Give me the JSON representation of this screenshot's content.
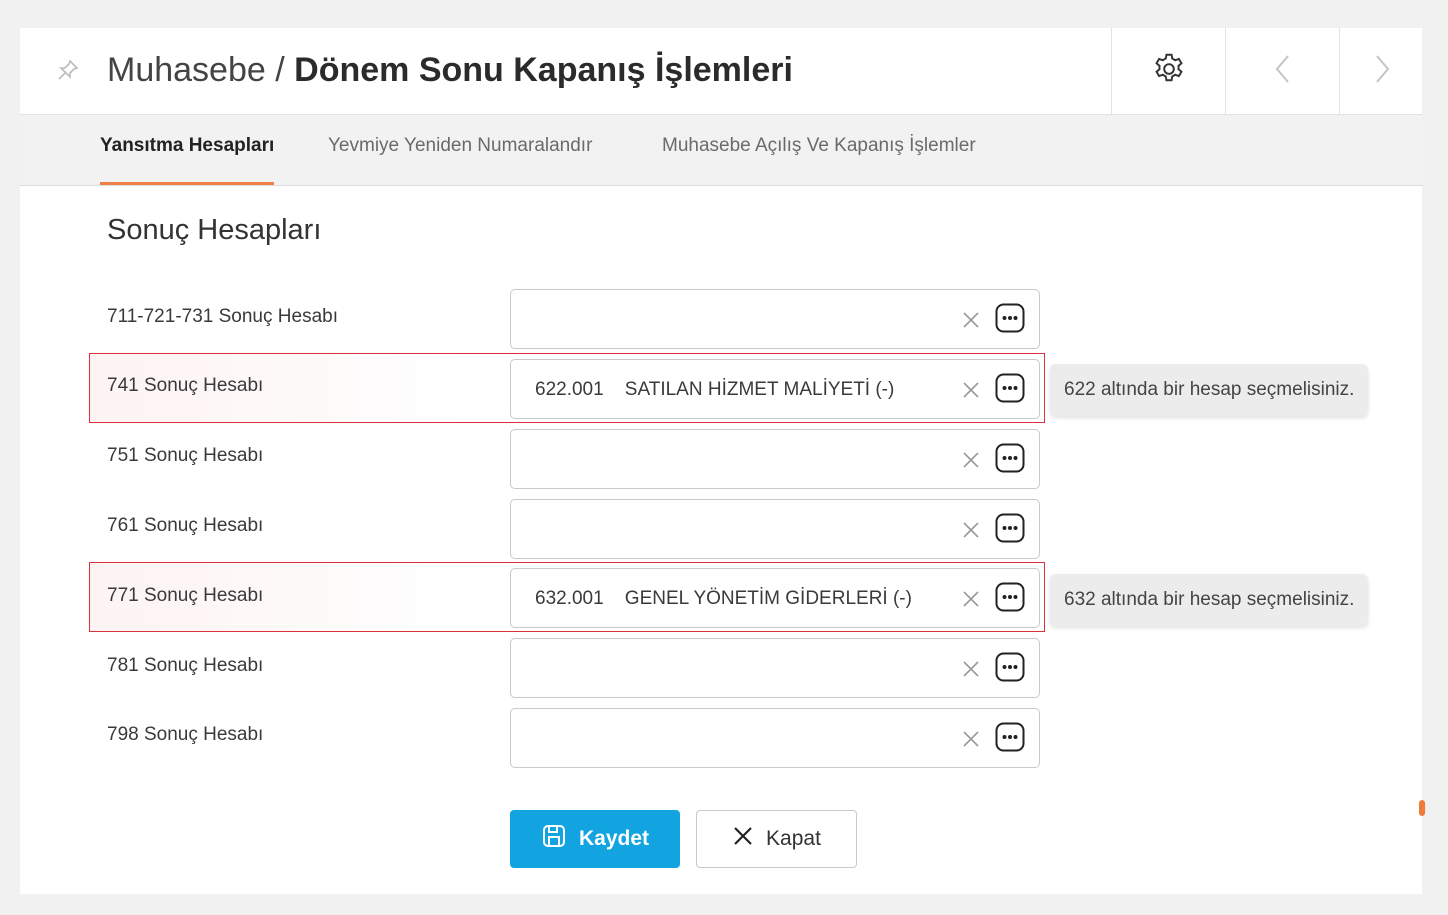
{
  "header": {
    "breadcrumb": "Muhasebe",
    "separator": "/",
    "page_title": "Dönem Sonu Kapanış İşlemleri"
  },
  "tabs": [
    {
      "label": "Yansıtma Hesapları",
      "active": true
    },
    {
      "label": "Yevmiye Yeniden Numaralandır",
      "active": false
    },
    {
      "label": "Muhasebe Açılış Ve Kapanış İşlemler",
      "active": false
    }
  ],
  "section": {
    "title": "Sonuç Hesapları"
  },
  "rows": [
    {
      "label": "711-721-731 Sonuç Hesabı",
      "value": "",
      "error": ""
    },
    {
      "label": "741 Sonuç Hesabı",
      "value": "622.001    SATILAN HİZMET MALİYETİ (-)",
      "error": "622 altında bir hesap seçmelisiniz."
    },
    {
      "label": "751 Sonuç Hesabı",
      "value": "",
      "error": ""
    },
    {
      "label": "761 Sonuç Hesabı",
      "value": "",
      "error": ""
    },
    {
      "label": "771 Sonuç Hesabı",
      "value": "632.001    GENEL YÖNETİM GİDERLERİ (-)",
      "error": "632 altında bir hesap seçmelisiniz."
    },
    {
      "label": "781 Sonuç Hesabı",
      "value": "",
      "error": ""
    },
    {
      "label": "798 Sonuç Hesabı",
      "value": "",
      "error": ""
    }
  ],
  "actions": {
    "save_label": "Kaydet",
    "close_label": "Kapat"
  },
  "colors": {
    "accent": "#12a4e0",
    "tab_underline": "#f0804a",
    "error_border": "#d9323a"
  },
  "icons": {
    "pin": "pin-icon",
    "settings": "gear-icon",
    "prev": "chevron-left-icon",
    "next": "chevron-right-icon",
    "clear": "close-icon",
    "lookup": "more-icon",
    "save": "save-icon",
    "close": "close-icon"
  }
}
